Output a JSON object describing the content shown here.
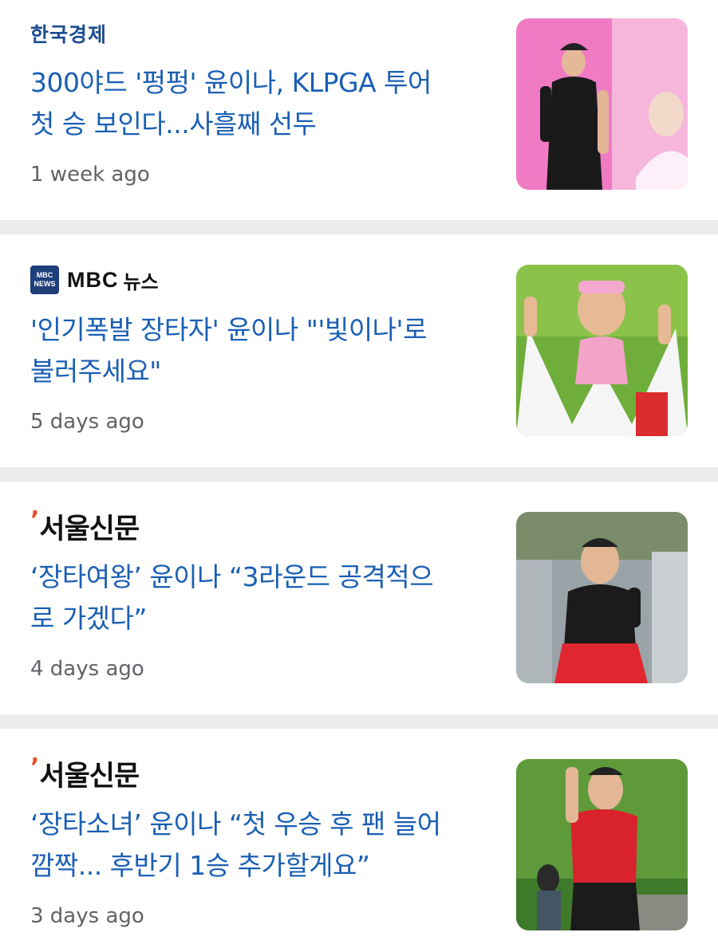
{
  "articles": [
    {
      "source": "한국경제",
      "headline_line1": "300야드 '펑펑' 윤이나, KLPGA 투어",
      "headline_line2": "첫 승 보인다...사흘째 선두",
      "time": "1 week ago"
    },
    {
      "source_logo": {
        "line1": "MBC",
        "line2": "NEWS"
      },
      "source_word": "MBC",
      "source_suffix": "뉴스",
      "headline_line1": "'인기폭발 장타자' 윤이나 \"'빛이나'로",
      "headline_line2": "불러주세요\"",
      "time": "5 days ago"
    },
    {
      "source": "서울신문",
      "headline_line1": "‘장타여왕’ 윤이나 “3라운드 공격적으",
      "headline_line2": "로 가겠다”",
      "time": "4 days ago"
    },
    {
      "source": "서울신문",
      "headline_line1": "‘장타소녀’ 윤이나 “첫 우승 후 팬 늘어",
      "headline_line2": "깜짝... 후반기 1승 추가할게요”",
      "time": "3 days ago"
    }
  ],
  "colors": {
    "headline": "#1a5fb4",
    "timestamp": "#5f6368",
    "separator": "#ececec",
    "seoul_accent": "#e8502a",
    "hk_source": "#1b4c8f"
  }
}
